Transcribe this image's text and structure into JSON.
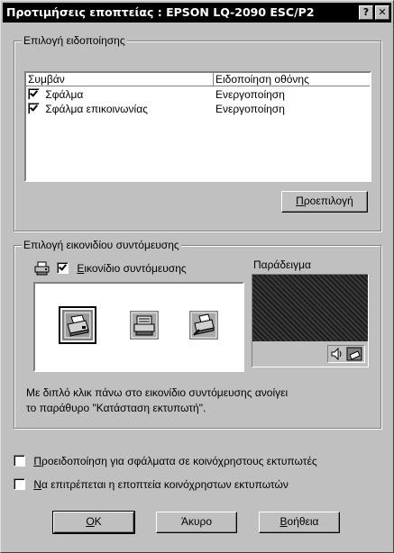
{
  "window": {
    "title": "Προτιμήσεις εποπτείας : EPSON LQ-2090 ESC/P2",
    "help_glyph": "?",
    "close_glyph": "✕"
  },
  "notification_group": {
    "legend": "Επιλογή ειδοποίησης",
    "columns": [
      "Συμβάν",
      "Ειδοποίηση οθόνης"
    ],
    "rows": [
      {
        "event": "Σφάλμα",
        "notification": "Ενεργοποίηση",
        "checked": true
      },
      {
        "event": "Σφάλμα επικοινωνίας",
        "notification": "Ενεργοποίηση",
        "checked": true
      }
    ],
    "default_button_prefix": "",
    "default_button_mnemonic": "Π",
    "default_button_rest": "ροεπιλογή"
  },
  "shortcut_group": {
    "legend": "Επιλογή εικονιδίου συντόμευσης",
    "checkbox_mnemonic": "Ε",
    "checkbox_rest": "ικονίδιο συντόμευσης",
    "checkbox_checked": true,
    "preview_label": "Παράδειγμα",
    "icons": [
      "printer-ok-icon",
      "printer-paper-icon",
      "printer-error-icon"
    ],
    "selected_icon": 0,
    "description_line1": "Με διπλό κλικ πάνω στο εικονίδιο συντόμευσης ανοίγει",
    "description_line2": "το παράθυρο \"Κατάσταση εκτυπωτή\"."
  },
  "options": {
    "shared_warning_mnemonic": "Π",
    "shared_warning_rest": "ροειδοποίηση για σφάλματα σε κοινόχρηστους εκτυπωτές",
    "shared_warning_checked": false,
    "allow_monitor_mnemonic": "Ν",
    "allow_monitor_rest": "α επιτρέπεται η εποπτεία κοινόχρηστων εκτυπωτών",
    "allow_monitor_checked": false
  },
  "buttons": {
    "ok_mnemonic": "Ο",
    "ok_rest": "K",
    "cancel_label": "Άκυρο",
    "help_mnemonic": "Β",
    "help_rest": "οήθεια"
  },
  "colors": {
    "face": "#c0c0c0",
    "titlebar": "#000000",
    "preview_screen": "#2a2a2a"
  }
}
